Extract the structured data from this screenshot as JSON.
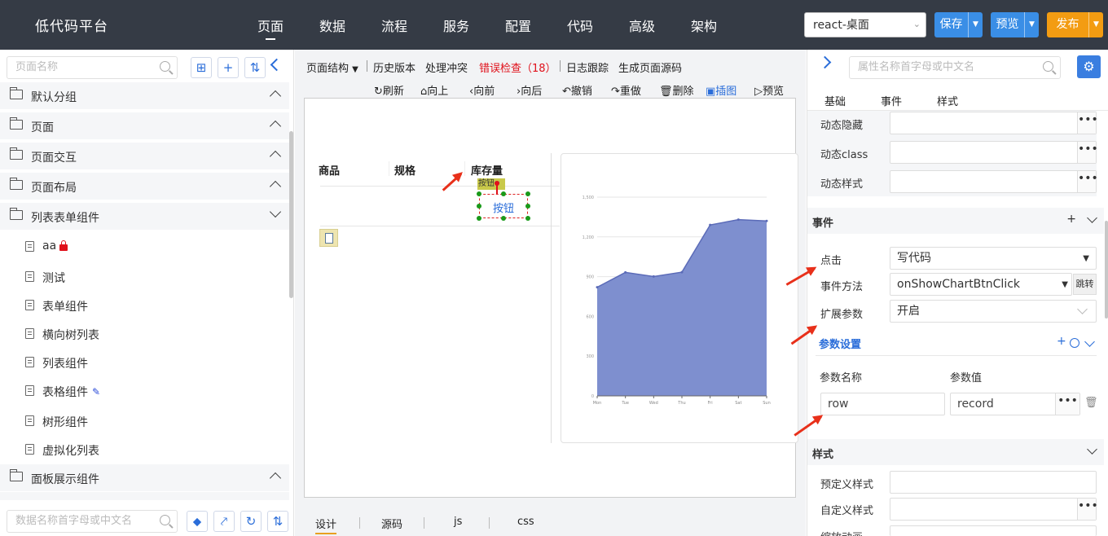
{
  "topbar": {
    "brand": "低代码平台",
    "nav": [
      "页面",
      "数据",
      "流程",
      "服务",
      "配置",
      "代码",
      "高级",
      "架构"
    ],
    "app_select": "react-桌面",
    "save_label": "保存",
    "preview_label": "预览",
    "publish_label": "发布",
    "colors": {
      "bg": "#353b45",
      "save": "#3a8ee6",
      "preview": "#3a8ee6",
      "publish": "#f39c12"
    }
  },
  "left": {
    "search_placeholder": "页面名称",
    "groups": [
      "默认分组",
      "页面",
      "页面交互",
      "页面布局",
      "列表表单组件"
    ],
    "items": [
      "aa",
      "测试",
      "表单组件",
      "横向树列表",
      "列表组件",
      "表格组件",
      "树形组件",
      "虚拟化列表"
    ],
    "group_last": "面板展示组件",
    "bottom_search_placeholder": "数据名称首字母或中文名"
  },
  "toolbar1": {
    "structure": "页面结构",
    "history": "历史版本",
    "conflict": "处理冲突",
    "error_check": "错误检查（18）",
    "log": "日志跟踪",
    "gen_source": "生成页面源码"
  },
  "toolbar2": {
    "refresh": "刷新",
    "up": "向上",
    "forward": "向前",
    "backward": "向后",
    "undo": "撤销",
    "redo": "重做",
    "delete": "删除",
    "image": "插图",
    "preview": "预览"
  },
  "canvas": {
    "headers": [
      "商品",
      "规格",
      "库存量"
    ],
    "button_tag": "按钮",
    "button_label": "按钮"
  },
  "chart_data": {
    "type": "area",
    "categories": [
      "Mon",
      "Tue",
      "Wed",
      "Thu",
      "Fri",
      "Sat",
      "Sun"
    ],
    "values": [
      820,
      932,
      901,
      934,
      1290,
      1330,
      1320
    ],
    "ylim": [
      0,
      1500
    ],
    "yticks": [
      "0",
      "300",
      "600",
      "900",
      "1,200",
      "1,500"
    ],
    "color": "#7e8fcf"
  },
  "bottom_tabs": [
    "设计",
    "源码",
    "js",
    "css"
  ],
  "right": {
    "search_placeholder": "属性名称首字母或中文名",
    "tabs": [
      "基础",
      "事件",
      "样式"
    ],
    "rows_top": [
      "动态隐藏",
      "动态class",
      "动态样式"
    ],
    "event_section": "事件",
    "click_label": "点击",
    "click_value": "写代码",
    "method_label": "事件方法",
    "method_value": "onShowChartBtnClick",
    "jump": "跳转",
    "ext_label": "扩展参数",
    "ext_value": "开启",
    "param_settings": "参数设置",
    "param_name_header": "参数名称",
    "param_value_header": "参数值",
    "param_name": "row",
    "param_value": "record",
    "style_section": "样式",
    "style_rows": [
      "预定义样式",
      "自定义样式",
      "缩放动画"
    ]
  }
}
